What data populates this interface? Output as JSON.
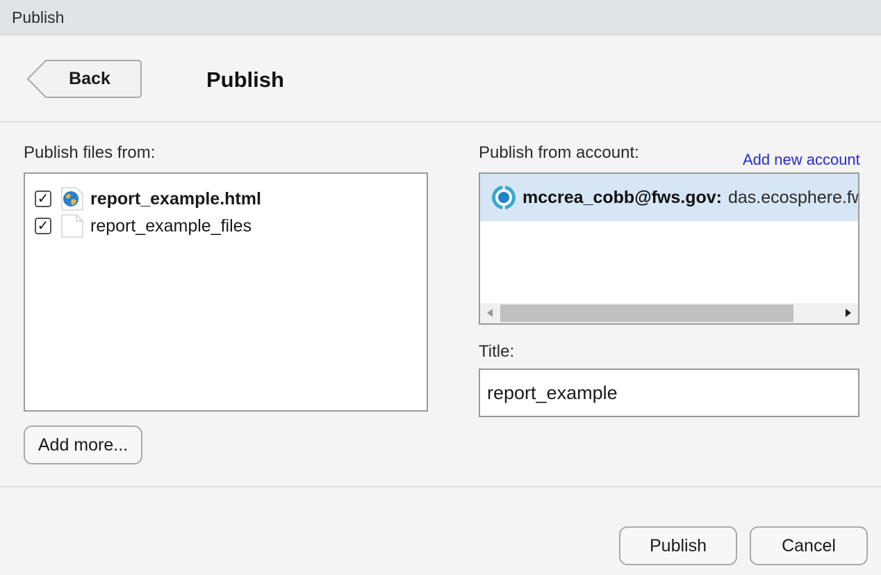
{
  "window": {
    "title": "Publish"
  },
  "header": {
    "back_label": "Back",
    "title": "Publish"
  },
  "files": {
    "label": "Publish files from:",
    "items": [
      {
        "name": "report_example.html",
        "checked": true,
        "icon": "web-page-icon"
      },
      {
        "name": "report_example_files",
        "checked": true,
        "icon": "document-icon"
      }
    ],
    "add_more_label": "Add more..."
  },
  "account": {
    "label": "Publish from account:",
    "add_new_label": "Add new account",
    "selected": {
      "email": "mccrea_cobb@fws.gov:",
      "server": "das.ecosphere.fws.gov"
    }
  },
  "title_field": {
    "label": "Title:",
    "value": "report_example"
  },
  "footer": {
    "publish_label": "Publish",
    "cancel_label": "Cancel"
  },
  "glyphs": {
    "check": "✓"
  },
  "colors": {
    "link": "#2a2ad6",
    "selected_row": "#d6e6f4",
    "account_icon": "#39a9c9"
  }
}
